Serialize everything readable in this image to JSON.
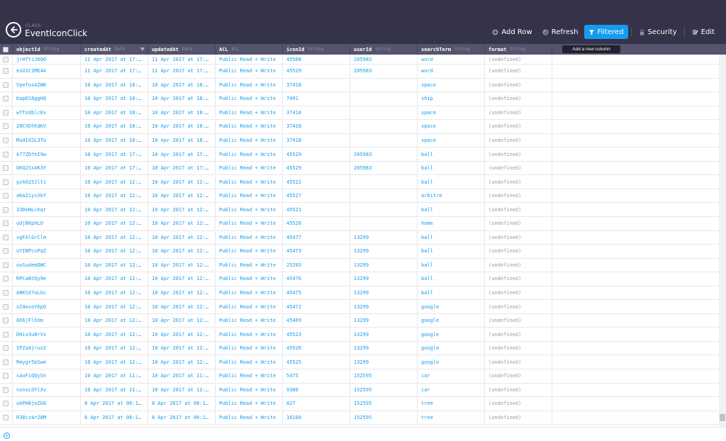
{
  "header": {
    "class_label": "CLASS",
    "class_name": "EventIconClick"
  },
  "toolbar": {
    "add_row": "Add Row",
    "refresh": "Refresh",
    "filtered": "Filtered",
    "security": "Security",
    "edit": "Edit"
  },
  "columns": [
    {
      "name": "objectId",
      "type": "String"
    },
    {
      "name": "createdAt",
      "type": "Date"
    },
    {
      "name": "updatedAt",
      "type": "Date"
    },
    {
      "name": "ACL",
      "type": "ACL"
    },
    {
      "name": "iconId",
      "type": "String"
    },
    {
      "name": "userId",
      "type": "String"
    },
    {
      "name": "searchTerm",
      "type": "String"
    },
    {
      "name": "format",
      "type": "String"
    }
  ],
  "add_column_label": "Add a new column",
  "colors": {
    "header_bg": "#34334a",
    "colhead_bg": "#55546e",
    "accent": "#169cee",
    "undefined_text": "#999aa6"
  },
  "rows": [
    [
      "jrHTtiJ6QO",
      "11 Apr 2017 at 17:…",
      "11 Apr 2017 at 17:…",
      "Public Read + Write",
      "45568",
      "205983",
      "word",
      "(undefined)"
    ],
    [
      "esU1C1ME4A",
      "11 Apr 2017 at 17:…",
      "11 Apr 2017 at 17:…",
      "Public Read + Write",
      "45529",
      "205983",
      "word",
      "(undefined)"
    ],
    [
      "VpefosAZW6",
      "10 Apr 2017 at 18:…",
      "10 Apr 2017 at 18:…",
      "Public Read + Write",
      "37418",
      "",
      "space",
      "(undefined)"
    ],
    [
      "KapES8ggHQ",
      "10 Apr 2017 at 18:…",
      "10 Apr 2017 at 18:…",
      "Public Read + Write",
      "7491",
      "",
      "ship",
      "(undefined)"
    ],
    [
      "wTTzdblcEv",
      "10 Apr 2017 at 18:…",
      "10 Apr 2017 at 18:…",
      "Public Read + Write",
      "37418",
      "",
      "space",
      "(undefined)"
    ],
    [
      "28CVDtKdKV",
      "10 Apr 2017 at 18:…",
      "10 Apr 2017 at 18:…",
      "Public Read + Write",
      "37418",
      "",
      "space",
      "(undefined)"
    ],
    [
      "MudId2L3To",
      "10 Apr 2017 at 18:…",
      "10 Apr 2017 at 18:…",
      "Public Read + Write",
      "37418",
      "",
      "space",
      "(undefined)"
    ],
    [
      "k77ZDfeI9w",
      "10 Apr 2017 at 17:…",
      "10 Apr 2017 at 17:…",
      "Public Read + Write",
      "45529",
      "205983",
      "ball",
      "(undefined)"
    ],
    [
      "GKQ2Ss4K3Y",
      "10 Apr 2017 at 17:…",
      "10 Apr 2017 at 17:…",
      "Public Read + Write",
      "45529",
      "205983",
      "ball",
      "(undefined)"
    ],
    [
      "gshO25Jlti",
      "10 Apr 2017 at 12:…",
      "10 Apr 2017 at 12:…",
      "Public Read + Write",
      "45522",
      "",
      "ball",
      "(undefined)"
    ],
    [
      "aKAZiysXkf",
      "10 Apr 2017 at 12:…",
      "10 Apr 2017 at 12:…",
      "Public Read + Write",
      "45527",
      "",
      "arbitre",
      "(undefined)"
    ],
    [
      "33DeNLcKqr",
      "10 Apr 2017 at 12:…",
      "10 Apr 2017 at 12:…",
      "Public Read + Write",
      "45521",
      "",
      "ball",
      "(undefined)"
    ],
    [
      "uUjB6phLO",
      "10 Apr 2017 at 12:…",
      "10 Apr 2017 at 12:…",
      "Public Read + Write",
      "45526",
      "",
      "home",
      "(undefined)"
    ],
    [
      "vgFAlGrClm",
      "10 Apr 2017 at 12:…",
      "10 Apr 2017 at 12:…",
      "Public Read + Write",
      "45477",
      "13299",
      "ball",
      "(undefined)"
    ],
    [
      "uYINPcxPqZ",
      "10 Apr 2017 at 12:…",
      "10 Apr 2017 at 12:…",
      "Public Read + Write",
      "45473",
      "13299",
      "ball",
      "(undefined)"
    ],
    [
      "ouSudemDWC",
      "10 Apr 2017 at 12:…",
      "10 Apr 2017 at 12:…",
      "Public Read + Write",
      "25283",
      "13299",
      "ball",
      "(undefined)"
    ],
    [
      "RPCaBtQy9e",
      "10 Apr 2017 at 12:…",
      "10 Apr 2017 at 12:…",
      "Public Read + Write",
      "45476",
      "13299",
      "ball",
      "(undefined)"
    ],
    [
      "ANKSX7uLUc",
      "10 Apr 2017 at 12:…",
      "10 Apr 2017 at 12:…",
      "Public Read + Write",
      "45475",
      "13299",
      "ball",
      "(undefined)"
    ],
    [
      "xZ4exoYKpO",
      "10 Apr 2017 at 12:…",
      "10 Apr 2017 at 12:…",
      "Public Read + Write",
      "45472",
      "13299",
      "google",
      "(undefined)"
    ],
    [
      "8X6jFlhXm",
      "10 Apr 2017 at 12:…",
      "10 Apr 2017 at 12:…",
      "Public Read + Write",
      "45469",
      "13299",
      "google",
      "(undefined)"
    ],
    [
      "DHix3u8rVv",
      "10 Apr 2017 at 12:…",
      "10 Apr 2017 at 12:…",
      "Public Read + Write",
      "45523",
      "13299",
      "google",
      "(undefined)"
    ],
    [
      "IPZaAjrux2",
      "10 Apr 2017 at 12:…",
      "10 Apr 2017 at 12:…",
      "Public Read + Write",
      "45526",
      "13299",
      "google",
      "(undefined)"
    ],
    [
      "Rmygr5bSwe",
      "10 Apr 2017 at 12:…",
      "10 Apr 2017 at 12:…",
      "Public Read + Write",
      "45525",
      "13299",
      "google",
      "(undefined)"
    ],
    [
      "sauFiQQySn",
      "10 Apr 2017 at 11:…",
      "10 Apr 2017 at 11:…",
      "Public Read + Write",
      "5475",
      "152595",
      "car",
      "(undefined)"
    ],
    [
      "nxnxLOYlXv",
      "10 Apr 2017 at 11:…",
      "10 Apr 2017 at 11:…",
      "Public Read + Write",
      "9380",
      "152595",
      "car",
      "(undefined)"
    ],
    [
      "oAPH8joZUG",
      "8 Apr 2017 at 06:1…",
      "8 Apr 2017 at 06:1…",
      "Public Read + Write",
      "827",
      "152595",
      "tree",
      "(undefined)"
    ],
    [
      "R38cz4r28M",
      "8 Apr 2017 at 06:1…",
      "8 Apr 2017 at 06:1…",
      "Public Read + Write",
      "16168",
      "152595",
      "tree",
      "(undefined)"
    ]
  ]
}
